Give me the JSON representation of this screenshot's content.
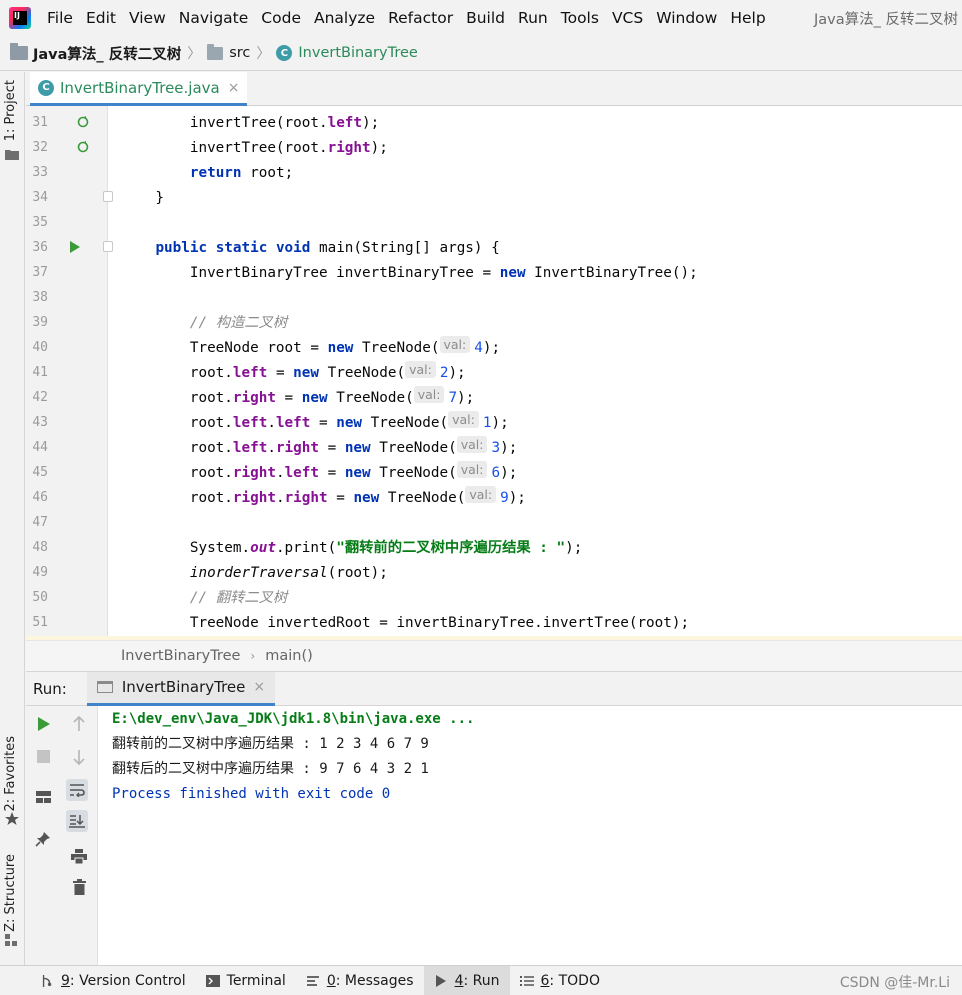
{
  "menubar": {
    "logo_text": "IJ",
    "items": [
      "File",
      "Edit",
      "View",
      "Navigate",
      "Code",
      "Analyze",
      "Refactor",
      "Build",
      "Run",
      "Tools",
      "VCS",
      "Window",
      "Help"
    ],
    "window_title": "Java算法_ 反转二叉树"
  },
  "navbar": {
    "project": "Java算法_ 反转二叉树",
    "folder": "src",
    "file": "InvertBinaryTree"
  },
  "left_strip": {
    "project_tab": "1: Project",
    "favorites_tab": "2: Favorites",
    "structure_tab": "Z: Structure"
  },
  "editor_tabs": {
    "active": "InvertBinaryTree.java",
    "class_icon_letter": "C",
    "close": "×"
  },
  "editor": {
    "lines": [
      {
        "n": "31",
        "parts": [
          [
            "",
            "        invertTree(root."
          ],
          [
            "fld",
            "left"
          ],
          [
            "",
            ");"
          ]
        ]
      },
      {
        "n": "32",
        "parts": [
          [
            "",
            "        invertTree(root."
          ],
          [
            "fld",
            "right"
          ],
          [
            "",
            ");"
          ]
        ]
      },
      {
        "n": "33",
        "parts": [
          [
            "",
            "        "
          ],
          [
            "kw",
            "return"
          ],
          [
            "",
            " root;"
          ]
        ]
      },
      {
        "n": "34",
        "parts": [
          [
            "",
            "    }"
          ]
        ]
      },
      {
        "n": "35",
        "parts": [
          [
            "",
            ""
          ]
        ]
      },
      {
        "n": "36",
        "parts": [
          [
            "",
            "    "
          ],
          [
            "kw",
            "public static void"
          ],
          [
            "",
            " main(String[] args) {"
          ]
        ]
      },
      {
        "n": "37",
        "parts": [
          [
            "",
            "        InvertBinaryTree invertBinaryTree = "
          ],
          [
            "kw",
            "new"
          ],
          [
            "",
            " InvertBinaryTree();"
          ]
        ]
      },
      {
        "n": "38",
        "parts": [
          [
            "",
            ""
          ]
        ]
      },
      {
        "n": "39",
        "parts": [
          [
            "",
            "        "
          ],
          [
            "cmt",
            "// 构造二叉树"
          ]
        ]
      },
      {
        "n": "40",
        "parts": [
          [
            "",
            "        TreeNode root = "
          ],
          [
            "kw",
            "new"
          ],
          [
            "",
            " TreeNode("
          ],
          [
            "hint",
            "val:"
          ],
          [
            "num",
            "4"
          ],
          [
            "",
            ");"
          ]
        ]
      },
      {
        "n": "41",
        "parts": [
          [
            "",
            "        root."
          ],
          [
            "fld",
            "left"
          ],
          [
            "",
            " = "
          ],
          [
            "kw",
            "new"
          ],
          [
            "",
            " TreeNode("
          ],
          [
            "hint",
            "val:"
          ],
          [
            "num",
            "2"
          ],
          [
            "",
            ");"
          ]
        ]
      },
      {
        "n": "42",
        "parts": [
          [
            "",
            "        root."
          ],
          [
            "fld",
            "right"
          ],
          [
            "",
            " = "
          ],
          [
            "kw",
            "new"
          ],
          [
            "",
            " TreeNode("
          ],
          [
            "hint",
            "val:"
          ],
          [
            "num",
            "7"
          ],
          [
            "",
            ");"
          ]
        ]
      },
      {
        "n": "43",
        "parts": [
          [
            "",
            "        root."
          ],
          [
            "fld",
            "left"
          ],
          [
            "",
            "."
          ],
          [
            "fld",
            "left"
          ],
          [
            "",
            " = "
          ],
          [
            "kw",
            "new"
          ],
          [
            "",
            " TreeNode("
          ],
          [
            "hint",
            "val:"
          ],
          [
            "num",
            "1"
          ],
          [
            "",
            ");"
          ]
        ]
      },
      {
        "n": "44",
        "parts": [
          [
            "",
            "        root."
          ],
          [
            "fld",
            "left"
          ],
          [
            "",
            "."
          ],
          [
            "fld",
            "right"
          ],
          [
            "",
            " = "
          ],
          [
            "kw",
            "new"
          ],
          [
            "",
            " TreeNode("
          ],
          [
            "hint",
            "val:"
          ],
          [
            "num",
            "3"
          ],
          [
            "",
            ");"
          ]
        ]
      },
      {
        "n": "45",
        "parts": [
          [
            "",
            "        root."
          ],
          [
            "fld",
            "right"
          ],
          [
            "",
            "."
          ],
          [
            "fld",
            "left"
          ],
          [
            "",
            " = "
          ],
          [
            "kw",
            "new"
          ],
          [
            "",
            " TreeNode("
          ],
          [
            "hint",
            "val:"
          ],
          [
            "num",
            "6"
          ],
          [
            "",
            ");"
          ]
        ]
      },
      {
        "n": "46",
        "parts": [
          [
            "",
            "        root."
          ],
          [
            "fld",
            "right"
          ],
          [
            "",
            "."
          ],
          [
            "fld",
            "right"
          ],
          [
            "",
            " = "
          ],
          [
            "kw",
            "new"
          ],
          [
            "",
            " TreeNode("
          ],
          [
            "hint",
            "val:"
          ],
          [
            "num",
            "9"
          ],
          [
            "",
            ");"
          ]
        ]
      },
      {
        "n": "47",
        "parts": [
          [
            "",
            ""
          ]
        ]
      },
      {
        "n": "48",
        "parts": [
          [
            "",
            "        System."
          ],
          [
            "fldi",
            "out"
          ],
          [
            "",
            ".print("
          ],
          [
            "str",
            "\"翻转前的二叉树中序遍历结果 : \""
          ],
          [
            "",
            ");"
          ]
        ]
      },
      {
        "n": "49",
        "parts": [
          [
            "",
            "        "
          ],
          [
            "stat",
            "inorderTraversal"
          ],
          [
            "",
            "(root);"
          ]
        ]
      },
      {
        "n": "50",
        "parts": [
          [
            "",
            "        "
          ],
          [
            "cmt",
            "// 翻转二叉树"
          ]
        ]
      },
      {
        "n": "51",
        "parts": [
          [
            "",
            "        TreeNode invertedRoot = invertBinaryTree.invertTree(root);"
          ]
        ]
      }
    ]
  },
  "editor_crumb": {
    "class": "InvertBinaryTree",
    "sep": "›",
    "method": "main()"
  },
  "run_panel": {
    "title": "Run:",
    "tab": "InvertBinaryTree",
    "close": "×",
    "console": [
      {
        "kind": "cmd",
        "text": "E:\\dev_env\\Java_JDK\\jdk1.8\\bin\\java.exe ..."
      },
      {
        "kind": "out",
        "text": "翻转前的二叉树中序遍历结果 : 1 2 3 4 6 7 9"
      },
      {
        "kind": "out",
        "text": "翻转后的二叉树中序遍历结果 : 9 7 6 4 3 2 1"
      },
      {
        "kind": "exit",
        "text": "Process finished with exit code 0"
      }
    ]
  },
  "statusbar": {
    "items": [
      {
        "key": "9",
        "label": ": Version Control",
        "active": false
      },
      {
        "key": "",
        "label": "Terminal",
        "active": false
      },
      {
        "key": "0",
        "label": ": Messages",
        "active": false
      },
      {
        "key": "4",
        "label": ": Run",
        "active": true
      },
      {
        "key": "6",
        "label": ": TODO",
        "active": false
      }
    ],
    "watermark": "CSDN @佳-Mr.Li"
  },
  "colors": {
    "accent": "#4083c9",
    "keyword": "#0033b3",
    "field": "#871094",
    "string": "#067d17",
    "number": "#1750eb",
    "comment": "#8c8c8c",
    "run_green": "#3b9b3b"
  }
}
